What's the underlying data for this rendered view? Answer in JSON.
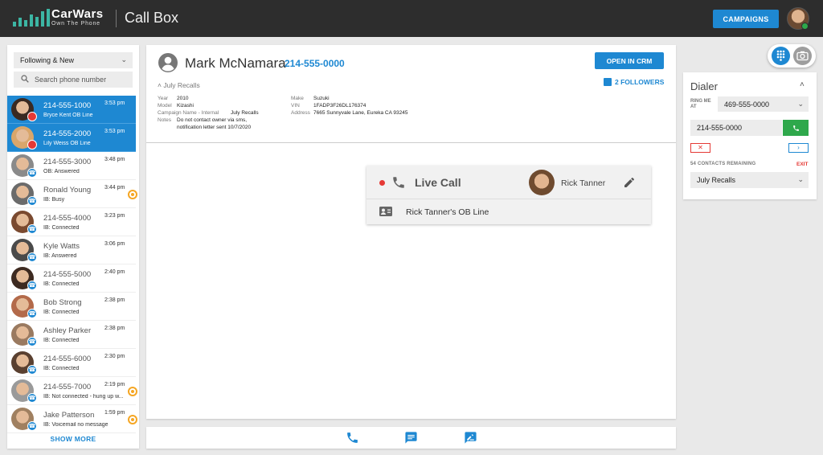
{
  "header": {
    "brand_name": "CarWars",
    "brand_tagline": "Own The Phone",
    "app_title": "Call Box",
    "campaigns_label": "CAMPAIGNS"
  },
  "sidebar": {
    "filter_value": "Following & New",
    "search_placeholder": "Search phone number",
    "show_more_label": "SHOW MORE",
    "items": [
      {
        "number": "214-555-1000",
        "sub": "Bryce Kent OB Line",
        "time": "3:53 pm",
        "selected": true,
        "badge": "red",
        "avatar": "#3a2a22"
      },
      {
        "number": "214-555-2000",
        "sub": "Lily Weiss OB Line",
        "time": "3:53 pm",
        "selected": true,
        "badge": "red",
        "avatar": "#d9a66b"
      },
      {
        "number": "214-555-3000",
        "sub": "OB: Answered",
        "time": "3:48 pm",
        "badge": "call",
        "avatar": "#8a8a8a"
      },
      {
        "number": "Ronald Young",
        "sub": "IB: Busy",
        "time": "3:44 pm",
        "badge": "call",
        "avatar": "#6b6b6b",
        "ring": true
      },
      {
        "number": "214-555-4000",
        "sub": "IB: Connected",
        "time": "3:23 pm",
        "badge": "call",
        "avatar": "#7a4a30"
      },
      {
        "number": "Kyle Watts",
        "sub": "IB: Answered",
        "time": "3:06 pm",
        "badge": "call",
        "avatar": "#4a4a4a"
      },
      {
        "number": "214-555-5000",
        "sub": "IB: Connected",
        "time": "2:40 pm",
        "badge": "call",
        "avatar": "#3d2a20"
      },
      {
        "number": "Bob Strong",
        "sub": "IB: Connected",
        "time": "2:38 pm",
        "badge": "call",
        "avatar": "#b36a4a"
      },
      {
        "number": "Ashley Parker",
        "sub": "IB: Connected",
        "time": "2:38 pm",
        "badge": "call",
        "avatar": "#9a7a60"
      },
      {
        "number": "214-555-6000",
        "sub": "IB: Connected",
        "time": "2:30 pm",
        "badge": "call",
        "avatar": "#5a4030"
      },
      {
        "number": "214-555-7000",
        "sub": "IB: Not connected - hung up w...",
        "time": "2:19 pm",
        "badge": "call",
        "avatar": "#9a9a9a",
        "ring": true
      },
      {
        "number": "Jake Patterson",
        "sub": "IB: Voicemail no message",
        "time": "1:59 pm",
        "badge": "call",
        "avatar": "#a08060",
        "ring": true
      }
    ]
  },
  "contact": {
    "name": "Mark McNamara",
    "phone": "214-555-0000",
    "crm_label": "OPEN IN CRM",
    "followers_label": "2 FOLLOWERS",
    "campaign_line": "July Recalls",
    "details_left": [
      {
        "label": "Year",
        "value": "2010"
      },
      {
        "label": "Model",
        "value": "Kizashi"
      },
      {
        "label": "Campaign Name - Internal",
        "value": "July Recalls"
      },
      {
        "label": "Notes",
        "value": "Do not contact owner via sms,",
        "value2": "notification letter sent 10/7/2020"
      }
    ],
    "details_right": [
      {
        "label": "Make",
        "value": "Suzuki"
      },
      {
        "label": "VIN",
        "value": "1FADP3F26DL176374"
      },
      {
        "label": "Address",
        "value": "7665 Sunnyvale Lane, Eureka CA 93245"
      }
    ]
  },
  "live_call": {
    "label": "Live Call",
    "agent_name": "Rick Tanner",
    "line_label": "Rick Tanner's OB Line"
  },
  "dialer": {
    "title": "Dialer",
    "ring_label": "RING ME AT",
    "ring_value": "469-555-0000",
    "dial_value": "214-555-0000",
    "x_label": "✕",
    "next_label": "›",
    "remaining_label": "54 CONTACTS REMAINING",
    "exit_label": "EXIT",
    "campaign_value": "July Recalls"
  },
  "colors": {
    "accent": "#1e88d2",
    "header_bg": "#2d2d2d",
    "success": "#2ea84b",
    "danger": "#e53935",
    "pending": "#f5a623"
  }
}
